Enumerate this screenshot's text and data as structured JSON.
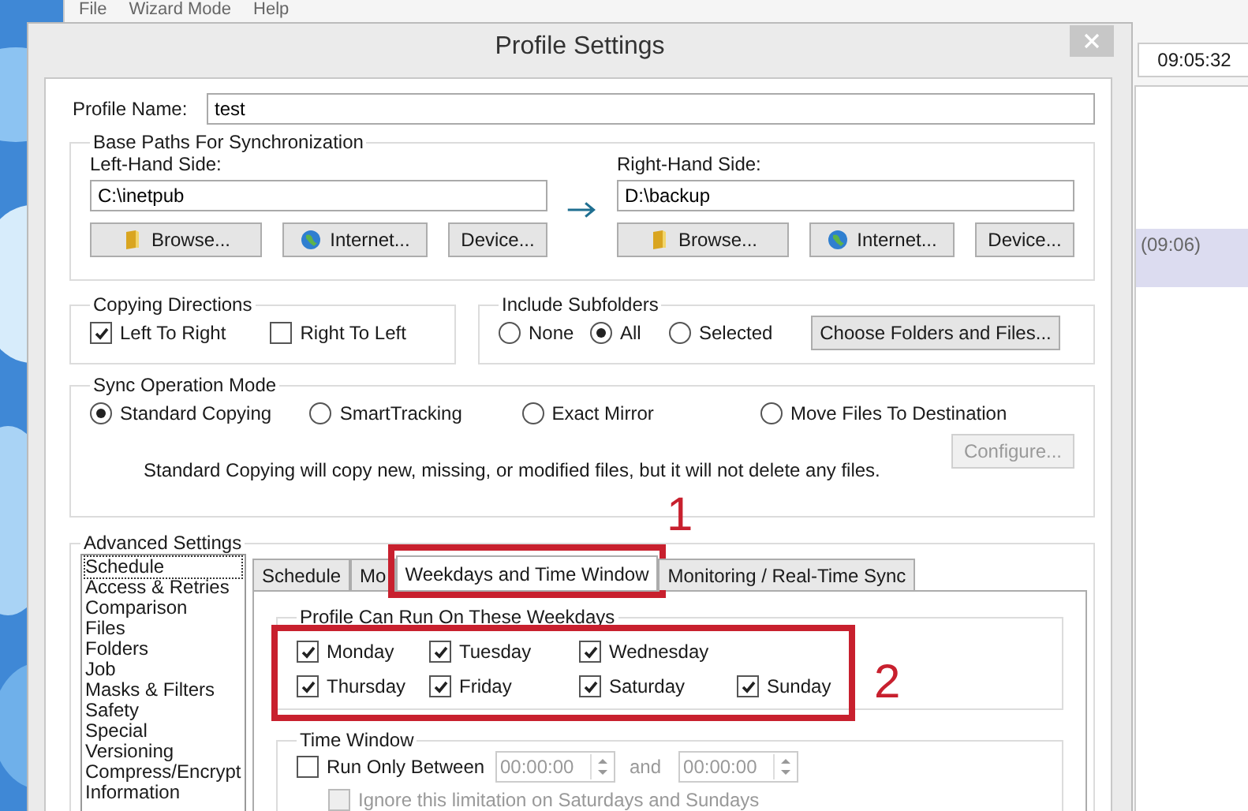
{
  "background_app": {
    "menu": [
      "File",
      "Wizard Mode",
      "Help"
    ],
    "clock": "09:05:32",
    "list_entry": "(09:06)"
  },
  "dialog": {
    "title": "Profile Settings"
  },
  "profile_name": {
    "label": "Profile Name:",
    "value": "test"
  },
  "base_paths": {
    "title": "Base Paths For Synchronization",
    "sides": [
      {
        "label": "Left-Hand Side:",
        "value": "C:\\inetpub",
        "buttons": [
          "Browse...",
          "Internet...",
          "Device..."
        ]
      },
      {
        "label": "Right-Hand Side:",
        "value": "D:\\backup",
        "buttons": [
          "Browse...",
          "Internet...",
          "Device..."
        ]
      }
    ]
  },
  "copying_directions": {
    "title": "Copying Directions",
    "options": [
      {
        "label": "Left To Right",
        "checked": true
      },
      {
        "label": "Right To Left",
        "checked": false
      }
    ]
  },
  "include_subfolders": {
    "title": "Include Subfolders",
    "options": [
      {
        "label": "None",
        "selected": false
      },
      {
        "label": "All",
        "selected": true
      },
      {
        "label": "Selected",
        "selected": false
      }
    ],
    "button": "Choose Folders and Files..."
  },
  "sync_mode": {
    "title": "Sync Operation Mode",
    "options": [
      {
        "label": "Standard Copying",
        "selected": true
      },
      {
        "label": "SmartTracking",
        "selected": false
      },
      {
        "label": "Exact Mirror",
        "selected": false
      },
      {
        "label": "Move Files To Destination",
        "selected": false
      }
    ],
    "configure": {
      "label": "Configure...",
      "disabled": true
    },
    "description": "Standard Copying will copy new, missing, or modified files, but it will not delete any files."
  },
  "advanced": {
    "title": "Advanced Settings",
    "sidebar": {
      "items": [
        {
          "label": "Schedule",
          "selected": true
        },
        {
          "label": "Access & Retries",
          "selected": false
        },
        {
          "label": "Comparison",
          "selected": false
        },
        {
          "label": "Files",
          "selected": false
        },
        {
          "label": "Folders",
          "selected": false
        },
        {
          "label": "Job",
          "selected": false
        },
        {
          "label": "Masks & Filters",
          "selected": false
        },
        {
          "label": "Safety",
          "selected": false
        },
        {
          "label": "Special",
          "selected": false
        },
        {
          "label": "Versioning",
          "selected": false
        },
        {
          "label": "Compress/Encrypt",
          "selected": false
        },
        {
          "label": "Information",
          "selected": false
        }
      ]
    },
    "tabs": [
      {
        "label": "Schedule",
        "selected": false
      },
      {
        "label": "Mo",
        "selected": false
      },
      {
        "label": "Weekdays and Time Window",
        "selected": true
      },
      {
        "label": "Monitoring / Real-Time Sync",
        "selected": false
      }
    ],
    "weekdays": {
      "title": "Profile Can Run On These Weekdays",
      "days": [
        {
          "label": "Monday",
          "checked": true
        },
        {
          "label": "Tuesday",
          "checked": true
        },
        {
          "label": "Wednesday",
          "checked": true
        },
        {
          "label": "Thursday",
          "checked": true
        },
        {
          "label": "Friday",
          "checked": true
        },
        {
          "label": "Saturday",
          "checked": true
        },
        {
          "label": "Sunday",
          "checked": true
        }
      ]
    },
    "time_window": {
      "title": "Time Window",
      "run_only_between": {
        "label": "Run Only Between",
        "checked": false
      },
      "start": "00:00:00",
      "and": "and",
      "end": "00:00:00",
      "ignore_weekends": {
        "label": "Ignore this limitation on Saturdays and Sundays",
        "checked": false,
        "disabled": true
      }
    }
  },
  "annotations": [
    {
      "label": "1"
    },
    {
      "label": "2"
    }
  ]
}
